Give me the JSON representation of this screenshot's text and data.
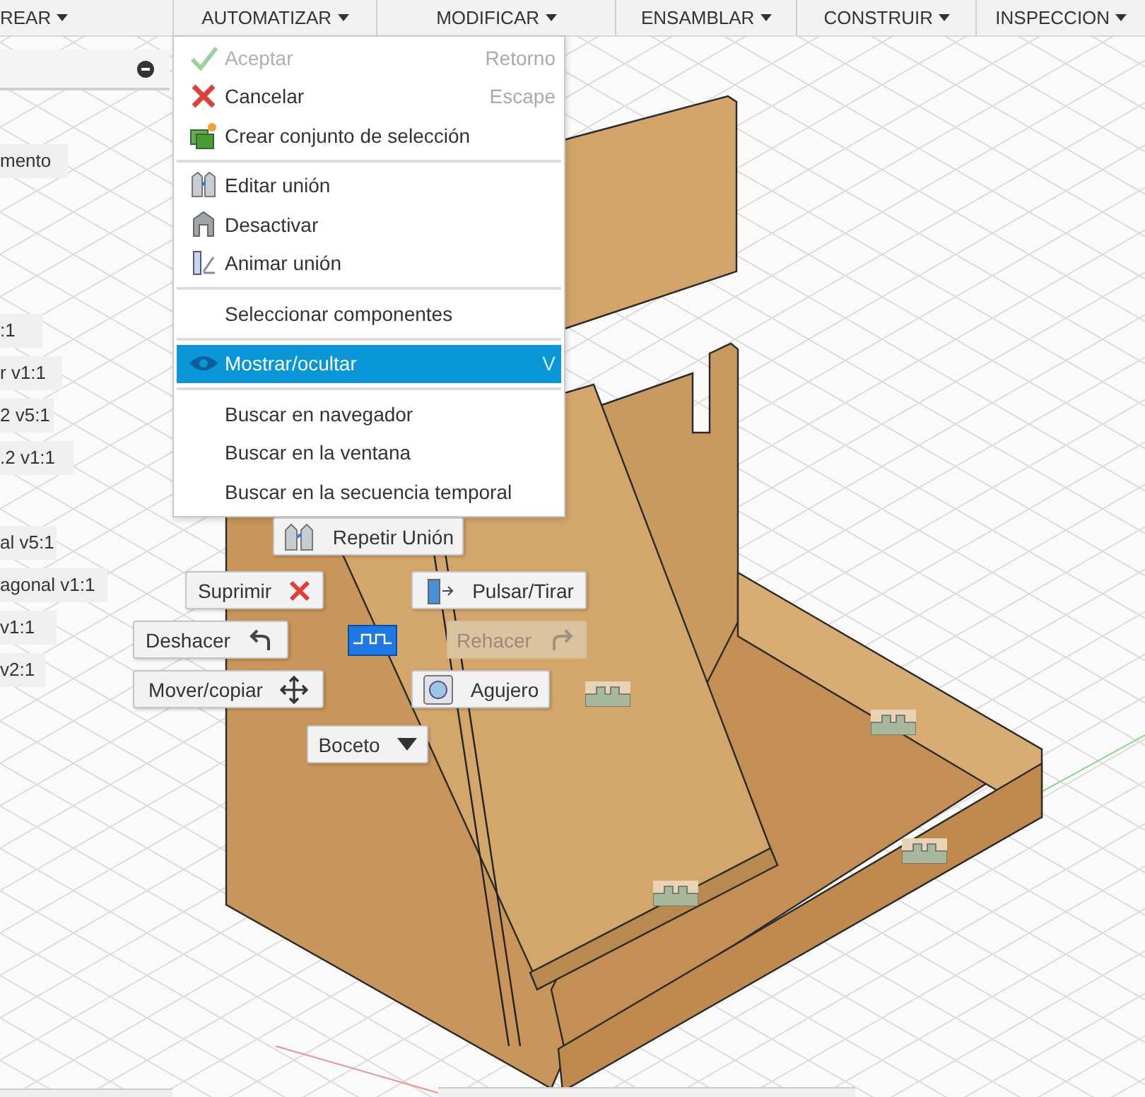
{
  "toolbar": {
    "menus": [
      {
        "label": "REAR"
      },
      {
        "label": "AUTOMATIZAR"
      },
      {
        "label": "MODIFICAR"
      },
      {
        "label": "ENSAMBLAR"
      },
      {
        "label": "CONSTRUIR"
      },
      {
        "label": "INSPECCION"
      }
    ]
  },
  "browser": {
    "labels": [
      "mento",
      ":1",
      "r v1:1",
      "2 v5:1",
      ".2 v1:1",
      "al v5:1",
      "agonal v1:1",
      "v1:1",
      "v2:1"
    ]
  },
  "context_menu": {
    "groups": [
      [
        {
          "label": "Aceptar",
          "shortcut": "Retorno",
          "disabled": true,
          "selected": false
        },
        {
          "label": "Cancelar",
          "shortcut": "Escape",
          "disabled": false,
          "selected": false
        },
        {
          "label": "Crear conjunto de selección",
          "disabled": false,
          "selected": false
        }
      ],
      [
        {
          "label": "Editar unión",
          "disabled": false,
          "selected": false
        },
        {
          "label": "Desactivar",
          "disabled": false,
          "selected": false
        },
        {
          "label": "Animar unión",
          "disabled": false,
          "selected": false
        }
      ],
      [
        {
          "label": "Seleccionar componentes",
          "disabled": false,
          "selected": false
        }
      ],
      [
        {
          "label": "Mostrar/ocultar",
          "shortcut": "V",
          "disabled": false,
          "selected": true
        }
      ],
      [
        {
          "label": "Buscar en navegador",
          "disabled": false,
          "selected": false
        },
        {
          "label": "Buscar en la ventana",
          "disabled": false,
          "selected": false
        },
        {
          "label": "Buscar en la secuencia temporal",
          "disabled": false,
          "selected": false
        }
      ]
    ]
  },
  "marking_menu": [
    {
      "label": "Repetir Unión",
      "disabled": false
    },
    {
      "label": "Suprimir",
      "disabled": false
    },
    {
      "label": "Pulsar/Tirar",
      "disabled": false
    },
    {
      "label": "Deshacer",
      "disabled": false
    },
    {
      "label": "Rehacer",
      "disabled": true
    },
    {
      "label": "Mover/copiar",
      "disabled": false
    },
    {
      "label": "Agujero",
      "disabled": false
    },
    {
      "label": "Boceto",
      "disabled": false
    }
  ]
}
